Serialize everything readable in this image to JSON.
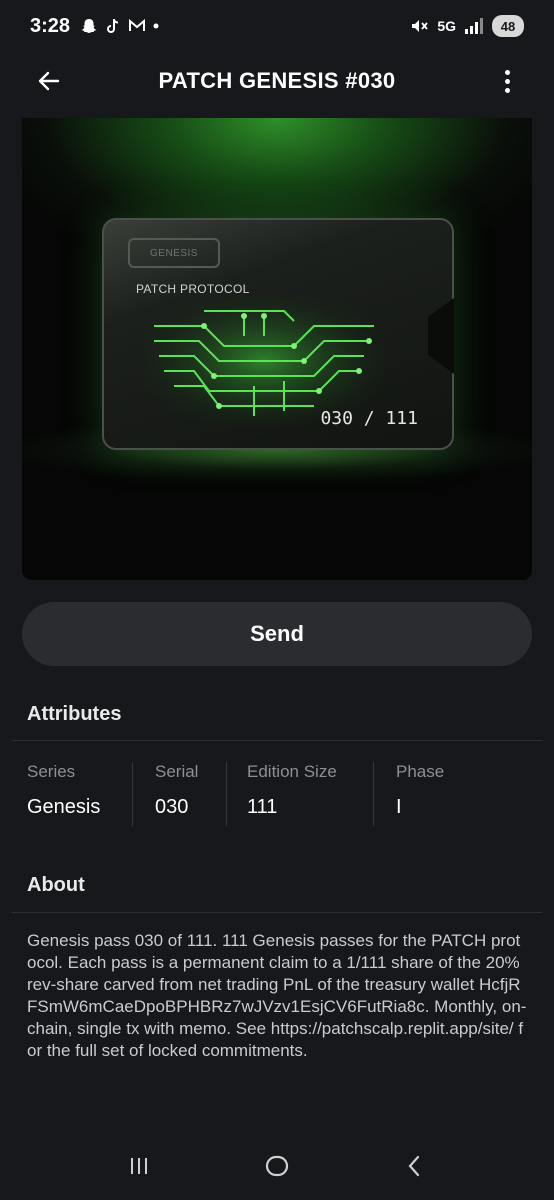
{
  "status_bar": {
    "time": "3:28",
    "notification_icons": [
      "snapchat-icon",
      "tiktok-icon",
      "gmail-icon",
      "dot-icon"
    ],
    "network": "5G",
    "battery": "48"
  },
  "app_bar": {
    "title": "PATCH GENESIS #030"
  },
  "hero": {
    "card_label": "GENESIS",
    "card_protocol": "PATCH PROTOCOL",
    "card_serial": "030 / 111",
    "accent_color": "#2fbf2a"
  },
  "actions": {
    "send_label": "Send"
  },
  "attributes": {
    "title": "Attributes",
    "items": [
      {
        "label": "Series",
        "value": "Genesis"
      },
      {
        "label": "Serial",
        "value": "030"
      },
      {
        "label": "Edition Size",
        "value": "111"
      },
      {
        "label": "Phase",
        "value": "I"
      }
    ]
  },
  "about": {
    "title": "About",
    "text": "Genesis pass 030 of 111. 111 Genesis passes for the PATCH protocol. Each pass is a permanent claim to a 1/111 share of the 20% rev-share carved from net trading PnL of the treasury wallet HcfjRFSmW6mCaeDpoBPHBRz7wJVzv1EsjCV6FutRia8c. Monthly, on-chain, single tx with memo. See https://patchscalp.replit.app/site/ for the full set of locked commitments."
  },
  "nav_bar": {
    "icons": [
      "recents-icon",
      "home-icon",
      "back-nav-icon"
    ]
  }
}
